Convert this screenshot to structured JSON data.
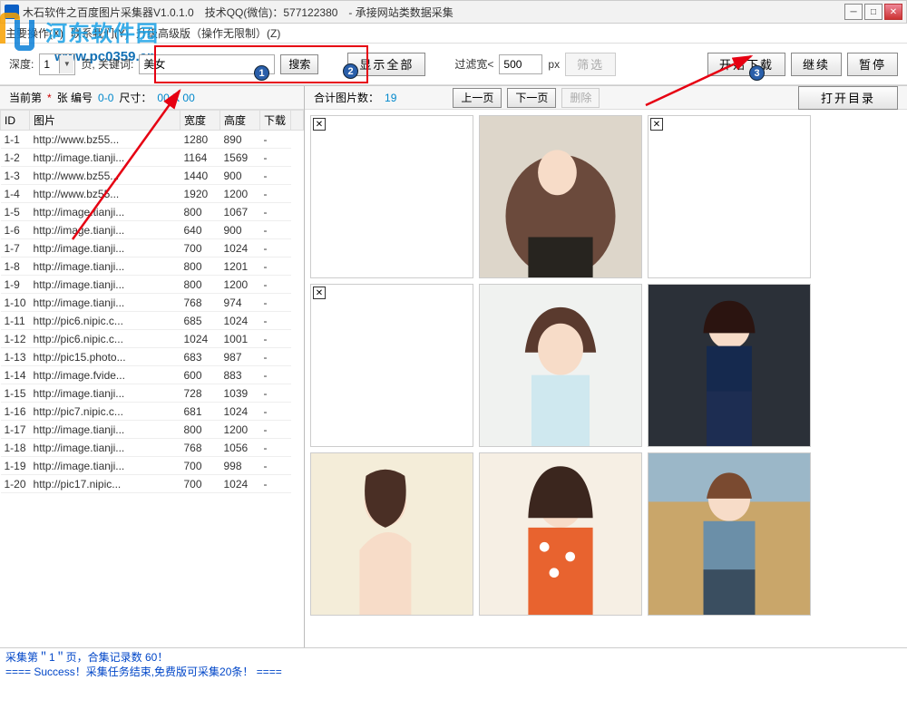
{
  "window": {
    "title": "木石软件之百度图片采集器V1.0.1.0　技术QQ(微信)：577122380　- 承接网站类数据采集"
  },
  "watermark": {
    "text": "河东软件园",
    "url": "www.pc0359.cn"
  },
  "menu": {
    "m1": "主要操作(X)",
    "m2": "联系我们(Y)",
    "m3": "升级高级版（操作无限制）(Z)"
  },
  "toolbar": {
    "depth_label": "深度:",
    "depth_value": "1",
    "page_label": "页, 关键词:",
    "keyword": "美女",
    "search_btn": "搜索",
    "show_all": "显示全部",
    "filter_label": "过滤宽<",
    "filter_value": "500",
    "px": "px",
    "filter_btn": "筛选",
    "start": "开始下载",
    "continue": "继续",
    "pause": "暂停"
  },
  "statusL": {
    "prefix": "当前第",
    "star": "*",
    "zhang": "张 编号",
    "num": "0-0",
    "size_lbl": "尺寸：",
    "size": "00 X 00"
  },
  "statusR": {
    "total_lbl": "合计图片数：",
    "total": "19",
    "prev": "上一页",
    "next": "下一页",
    "del": "删除",
    "opendir": "打开目录"
  },
  "columns": {
    "id": "ID",
    "pic": "图片",
    "w": "宽度",
    "h": "高度",
    "dl": "下载"
  },
  "rows": [
    {
      "id": "1-1",
      "url": "http://www.bz55...",
      "w": "1280",
      "h": "890",
      "dl": "-"
    },
    {
      "id": "1-2",
      "url": "http://image.tianji...",
      "w": "1164",
      "h": "1569",
      "dl": "-"
    },
    {
      "id": "1-3",
      "url": "http://www.bz55...",
      "w": "1440",
      "h": "900",
      "dl": "-"
    },
    {
      "id": "1-4",
      "url": "http://www.bz55...",
      "w": "1920",
      "h": "1200",
      "dl": "-"
    },
    {
      "id": "1-5",
      "url": "http://image.tianji...",
      "w": "800",
      "h": "1067",
      "dl": "-"
    },
    {
      "id": "1-6",
      "url": "http://image.tianji...",
      "w": "640",
      "h": "900",
      "dl": "-"
    },
    {
      "id": "1-7",
      "url": "http://image.tianji...",
      "w": "700",
      "h": "1024",
      "dl": "-"
    },
    {
      "id": "1-8",
      "url": "http://image.tianji...",
      "w": "800",
      "h": "1201",
      "dl": "-"
    },
    {
      "id": "1-9",
      "url": "http://image.tianji...",
      "w": "800",
      "h": "1200",
      "dl": "-"
    },
    {
      "id": "1-10",
      "url": "http://image.tianji...",
      "w": "768",
      "h": "974",
      "dl": "-"
    },
    {
      "id": "1-11",
      "url": "http://pic6.nipic.c...",
      "w": "685",
      "h": "1024",
      "dl": "-"
    },
    {
      "id": "1-12",
      "url": "http://pic6.nipic.c...",
      "w": "1024",
      "h": "1001",
      "dl": "-"
    },
    {
      "id": "1-13",
      "url": "http://pic15.photo...",
      "w": "683",
      "h": "987",
      "dl": "-"
    },
    {
      "id": "1-14",
      "url": "http://image.fvide...",
      "w": "600",
      "h": "883",
      "dl": "-"
    },
    {
      "id": "1-15",
      "url": "http://image.tianji...",
      "w": "728",
      "h": "1039",
      "dl": "-"
    },
    {
      "id": "1-16",
      "url": "http://pic7.nipic.c...",
      "w": "681",
      "h": "1024",
      "dl": "-"
    },
    {
      "id": "1-17",
      "url": "http://image.tianji...",
      "w": "800",
      "h": "1200",
      "dl": "-"
    },
    {
      "id": "1-18",
      "url": "http://image.tianji...",
      "w": "768",
      "h": "1056",
      "dl": "-"
    },
    {
      "id": "1-19",
      "url": "http://image.tianji...",
      "w": "700",
      "h": "998",
      "dl": "-"
    },
    {
      "id": "1-20",
      "url": "http://pic17.nipic...",
      "w": "700",
      "h": "1024",
      "dl": "-"
    }
  ],
  "footer": {
    "l1": "采集第＂1＂页，合集记录数 60！",
    "l2": "==== Success！采集任务结束,免费版可采集20条！ ===="
  }
}
